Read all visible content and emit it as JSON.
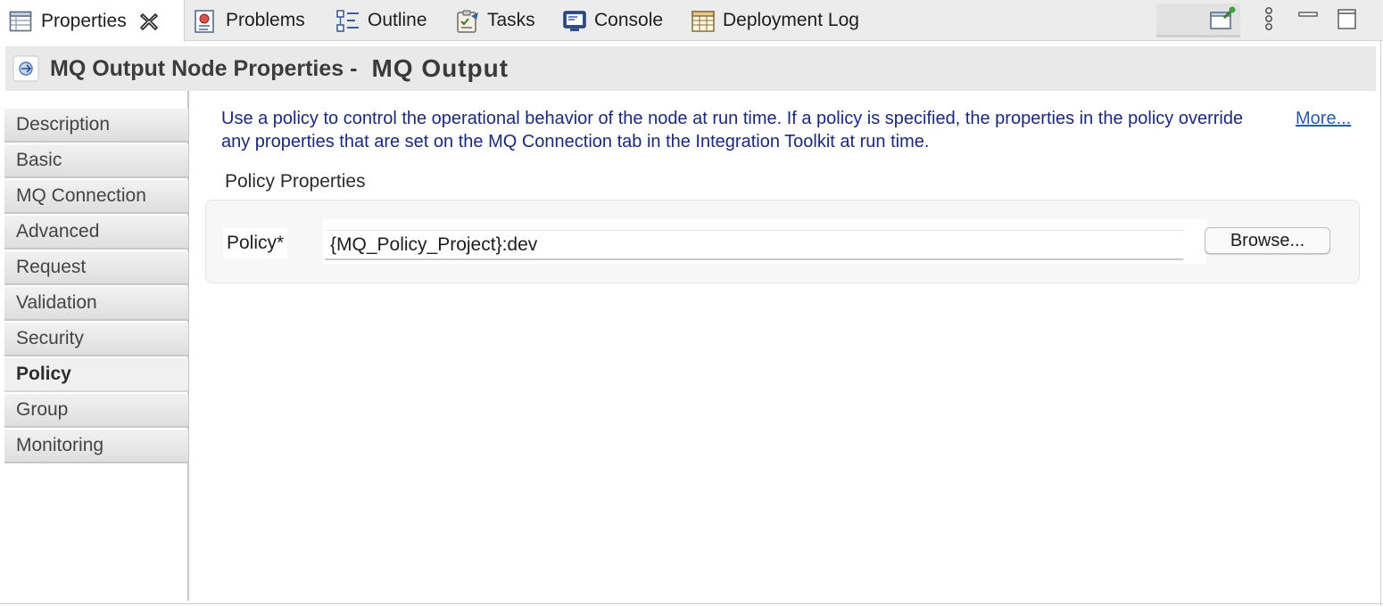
{
  "tabs": [
    {
      "label": "Properties",
      "icon": "properties-table-icon",
      "active": true
    },
    {
      "label": "Problems",
      "icon": "problems-icon"
    },
    {
      "label": "Outline",
      "icon": "outline-icon"
    },
    {
      "label": "Tasks",
      "icon": "tasks-icon"
    },
    {
      "label": "Console",
      "icon": "console-icon"
    },
    {
      "label": "Deployment Log",
      "icon": "deployment-log-icon"
    }
  ],
  "header": {
    "title": "MQ Output Node Properties -",
    "node_name": "MQ Output"
  },
  "sidebar": {
    "items": [
      {
        "label": "Description"
      },
      {
        "label": "Basic"
      },
      {
        "label": "MQ Connection"
      },
      {
        "label": "Advanced"
      },
      {
        "label": "Request"
      },
      {
        "label": "Validation"
      },
      {
        "label": "Security"
      },
      {
        "label": "Policy",
        "selected": true
      },
      {
        "label": "Group"
      },
      {
        "label": "Monitoring"
      }
    ]
  },
  "main": {
    "description": "Use a policy to control the operational behavior of the node at run time. If a policy is specified, the properties in the policy override any properties that are set on the MQ Connection tab in the Integration Toolkit at run time.",
    "more_link": "More...",
    "section_label": "Policy Properties",
    "policy_label": "Policy*",
    "policy_value": "{MQ_Policy_Project}:dev",
    "browse_label": "Browse..."
  },
  "colors": {
    "description_text": "#1b2a78",
    "link": "#2a5db0",
    "tabbar_bg": "#ececec",
    "title_bg": "#e9e9e9"
  }
}
